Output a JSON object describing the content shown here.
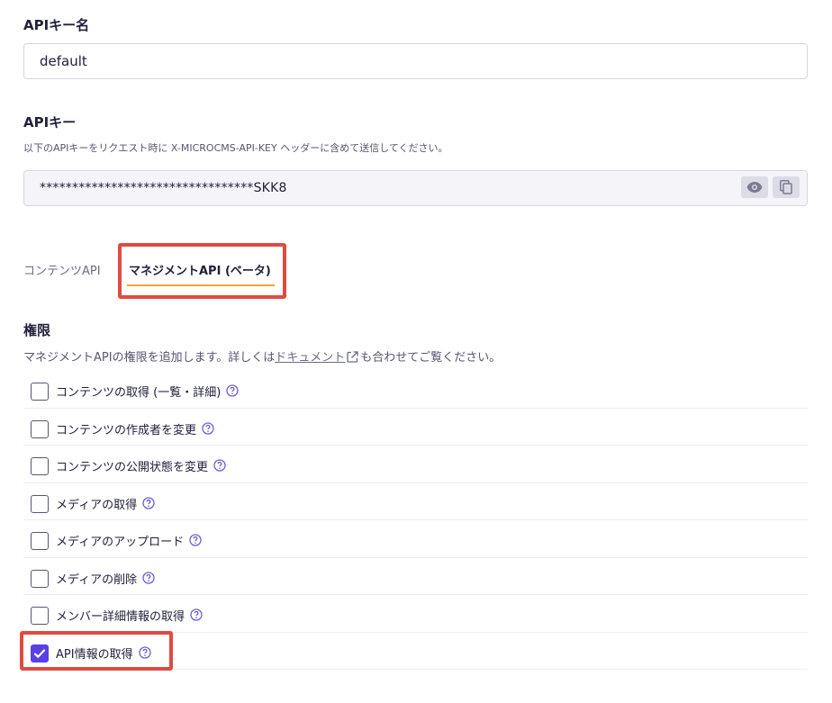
{
  "apikey_name": {
    "label": "APIキー名",
    "value": "default"
  },
  "apikey": {
    "label": "APIキー",
    "helper": "以下のAPIキーをリクエスト時に X-MICROCMS-API-KEY ヘッダーに含めて送信してください。",
    "masked_value": "*********************************SKK8",
    "eye_icon": "eye-icon",
    "copy_icon": "copy-icon"
  },
  "tabs": [
    {
      "label": "コンテンツAPI",
      "active": false
    },
    {
      "label": "マネジメントAPI (ベータ)",
      "active": true
    }
  ],
  "permissions": {
    "title": "権限",
    "desc_before": "マネジメントAPIの権限を追加します。詳しくは",
    "doc_link": "ドキュメント",
    "desc_after": "も合わせてご覧ください。",
    "items": [
      {
        "label": "コンテンツの取得 (一覧・詳細)",
        "checked": false
      },
      {
        "label": "コンテンツの作成者を変更",
        "checked": false
      },
      {
        "label": "コンテンツの公開状態を変更",
        "checked": false
      },
      {
        "label": "メディアの取得",
        "checked": false
      },
      {
        "label": "メディアのアップロード",
        "checked": false
      },
      {
        "label": "メディアの削除",
        "checked": false
      },
      {
        "label": "メンバー詳細情報の取得",
        "checked": false
      },
      {
        "label": "API情報の取得",
        "checked": true
      }
    ]
  },
  "colors": {
    "accent": "#5b3fe6",
    "tab_underline": "#f0a53c",
    "highlight": "#e04b41"
  }
}
